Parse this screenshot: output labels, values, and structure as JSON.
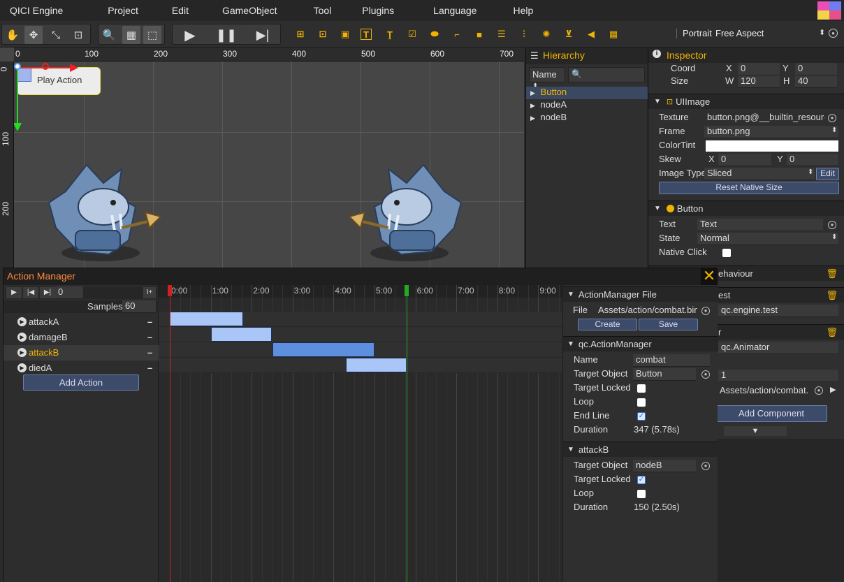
{
  "menubar": {
    "items": [
      "QICI Engine",
      "Project",
      "Edit",
      "GameObject",
      "Tool",
      "Plugins",
      "Language",
      "Help"
    ]
  },
  "toolbar": {
    "orientation": "Portrait",
    "aspect": "Free Aspect"
  },
  "scene": {
    "ruler_top": [
      "0",
      "100",
      "200",
      "300",
      "400",
      "500",
      "600",
      "700"
    ],
    "ruler_left": [
      "0",
      "100",
      "200"
    ],
    "button_label": "Play Action"
  },
  "hierarchy": {
    "title": "Hierarchy",
    "filter_label": "Name",
    "items": [
      "Button",
      "nodeA",
      "nodeB"
    ],
    "selected": "Button"
  },
  "inspector": {
    "title": "Inspector",
    "coord": {
      "label": "Coord",
      "x_label": "X",
      "x": "0",
      "y_label": "Y",
      "y": "0"
    },
    "size": {
      "label": "Size",
      "w_label": "W",
      "w": "120",
      "h_label": "H",
      "h": "40"
    },
    "uiimage": {
      "title": "UIImage",
      "texture_label": "Texture",
      "texture": "button.png@__builtin_resource",
      "frame_label": "Frame",
      "frame": "button.png",
      "colortint_label": "ColorTint",
      "skew_label": "Skew",
      "skew_x_label": "X",
      "skew_x": "0",
      "skew_y_label": "Y",
      "skew_y": "0",
      "imagetype_label": "Image Type",
      "imagetype": "Sliced",
      "edit_label": "Edit",
      "reset_label": "Reset Native Size"
    },
    "button": {
      "title": "Button",
      "text_label": "Text",
      "text": "Text",
      "state_label": "State",
      "state": "Normal",
      "native_click_label": "Native Click"
    },
    "partial": {
      "behaviour": "ehaviour",
      "test": "est",
      "test_value": "qc.engine.test",
      "animator_frag": "r",
      "animator_value": "qc.Animator",
      "num_frag": "1",
      "action_file": "Assets/action/combat.",
      "add_component": "Add Component"
    }
  },
  "action_manager": {
    "title": "Action Manager",
    "frame_value": "0",
    "samples_label": "Samples",
    "samples": "60",
    "actions": [
      "attackA",
      "damageB",
      "attackB",
      "diedA"
    ],
    "selected_action": "attackB",
    "add_action_label": "Add Action",
    "timeline_labels": [
      "0:00",
      "1:00",
      "2:00",
      "3:00",
      "4:00",
      "5:00",
      "6:00",
      "7:00",
      "8:00",
      "9:00"
    ],
    "clips": [
      {
        "action": "attackA",
        "start": 0.0,
        "end": 1.8
      },
      {
        "action": "damageB",
        "start": 1.0,
        "end": 2.5
      },
      {
        "action": "attackB",
        "start": 2.5,
        "end": 5.0
      },
      {
        "action": "diedA",
        "start": 4.3,
        "end": 5.78
      }
    ],
    "end_line": 5.78,
    "colors": {
      "clip": "#a9c6f7",
      "clip_selected": "#5e8ede",
      "accent": "#f0b400",
      "end_line": "#22aa22",
      "start_line": "#cc2222"
    },
    "file_section": {
      "title": "ActionManager File",
      "file_label": "File",
      "file": "Assets/action/combat.bin",
      "create_label": "Create",
      "save_label": "Save"
    },
    "manager_section": {
      "title": "qc.ActionManager",
      "name_label": "Name",
      "name": "combat",
      "target_label": "Target Object",
      "target": "Button",
      "locked_label": "Target Locked",
      "loop_label": "Loop",
      "endline_label": "End Line",
      "duration_label": "Duration",
      "duration": "347 (5.78s)"
    },
    "action_section": {
      "title": "attackB",
      "target_label": "Target Object",
      "target": "nodeB",
      "locked_label": "Target Locked",
      "loop_label": "Loop",
      "duration_label": "Duration",
      "duration": "150 (2.50s)"
    }
  }
}
